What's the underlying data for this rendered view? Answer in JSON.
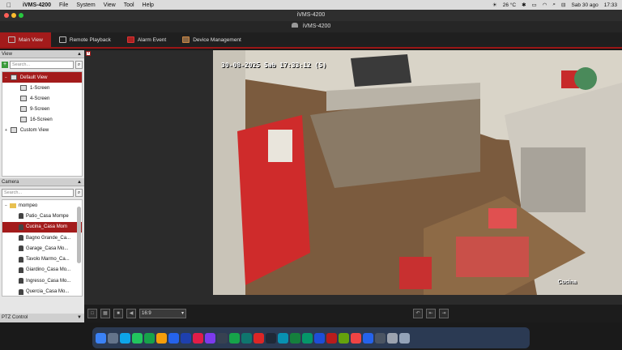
{
  "menubar": {
    "app_name": "iVMS-4200",
    "items": [
      "File",
      "System",
      "View",
      "Tool",
      "Help"
    ],
    "temperature": "26 °C",
    "datetime": "Sab 30 ago",
    "time": "17:33"
  },
  "window": {
    "title": "iVMS-4200"
  },
  "logo": {
    "title": "iVMS-4200"
  },
  "tabs": [
    {
      "label": "Main View",
      "active": true
    },
    {
      "label": "Remote Playback"
    },
    {
      "label": "Alarm Event"
    },
    {
      "label": "Device Management"
    }
  ],
  "view_panel": {
    "header": "View",
    "search_placeholder": "Search...",
    "items": [
      "Default View",
      "1-Screen",
      "4-Screen",
      "9-Screen",
      "16-Screen",
      "Custom View"
    ]
  },
  "camera_panel": {
    "header": "Camera",
    "search_placeholder": "Search...",
    "group": "mompeo",
    "cameras": [
      "Patio_Casa Mompe",
      "Cucina_Casa Mom",
      "Bagno Grande_Ca...",
      "Garage_Casa Mo...",
      "Tavolo Marmo_Ca...",
      "Giardino_Casa Mo...",
      "Ingresso_Casa Mo...",
      "Quercia_Casa Mo..."
    ],
    "selected_index": 1
  },
  "ptz": {
    "label": "PTZ Control"
  },
  "video": {
    "osd_timestamp": "30-08-2025 Sab 17:33:12 (S)",
    "osd_name": "Cucina"
  },
  "bottom": {
    "ratio": "16:9"
  },
  "colors": {
    "accent": "#a31b1b"
  }
}
